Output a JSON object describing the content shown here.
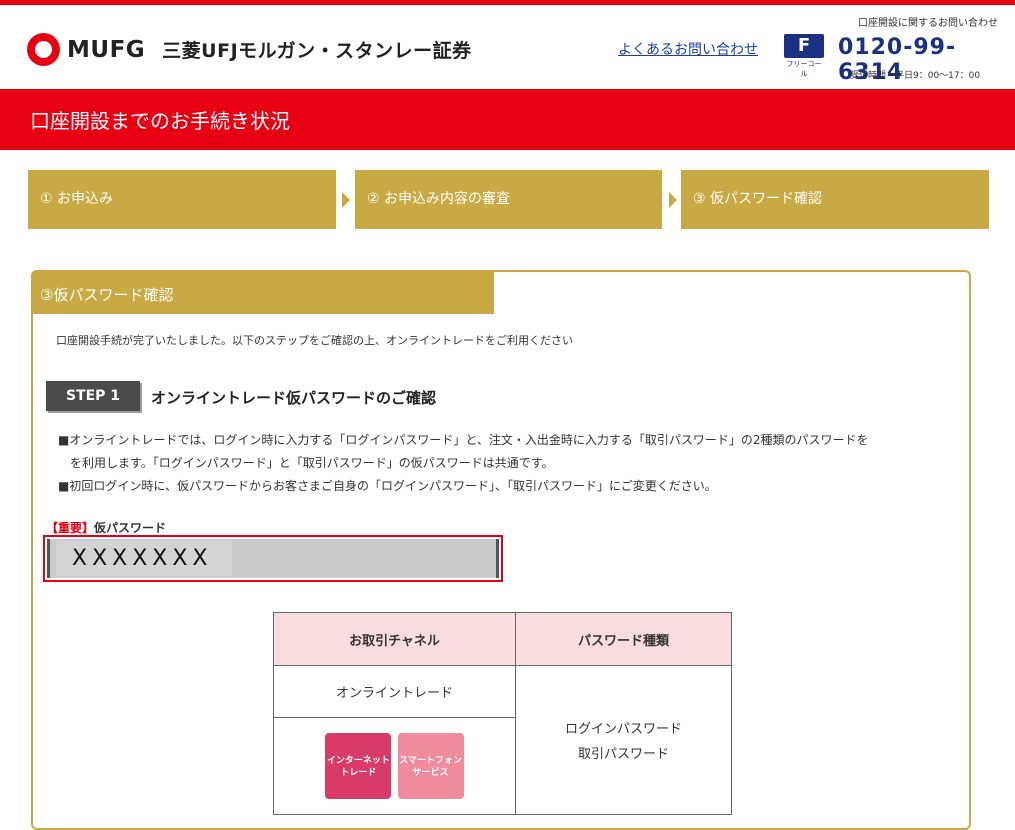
{
  "brand": {
    "logo_text": "MUFG",
    "company_name": "三菱UFJモルガン・スタンレー証券",
    "accent_color": "#e60012",
    "gold_color": "#c9a943"
  },
  "header": {
    "faq_link": "よくあるお問い合わせ",
    "freecall_icon": "freecall-icon",
    "freecall_label": "フリーコール",
    "phone_inquiry": "口座開設に関するお問い合わせ",
    "phone_number": "0120-99-6314",
    "hours": "受付時間　平日9：00〜17：00"
  },
  "banner": {
    "title": "口座開設までのお手続き状況"
  },
  "steps": [
    {
      "label": "① お申込み"
    },
    {
      "label": "② お申込み内容の審査"
    },
    {
      "label": "③ 仮パスワード確認"
    }
  ],
  "section": {
    "title": "③仮パスワード確認",
    "intro": "口座開設手続が完了いたしました。以下のステップをご確認の上、オンライントレードをご利用ください",
    "step_badge": "STEP 1",
    "step_title": "オンライントレード仮パスワードのご確認",
    "bullets": [
      "■オンライントレードでは、ログイン時に入力する「ログインパスワード」と、注文・入出金時に入力する「取引パスワード」の2種類のパスワードを",
      "　を利用します。「ログインパスワード」と「取引パスワード」の仮パスワードは共通です。",
      "■初回ログイン時に、仮パスワードからお客さまご自身の「ログインパスワード」、「取引パスワード」にご変更ください。"
    ],
    "important_tag": "【重要】",
    "important_label": "仮パスワード",
    "password": "XXXXXXX"
  },
  "table": {
    "headers": [
      "お取引チャネル",
      "パスワード種類"
    ],
    "channel_online": "オンライントレード",
    "tiles": [
      {
        "label_line1": "インターネット",
        "label_line2": "トレード",
        "color": "#d83a6a"
      },
      {
        "label_line1": "スマートフォン",
        "label_line2": "サービス",
        "color": "#f08a9e"
      }
    ],
    "password_type_line1": "ログインパスワード",
    "password_type_line2": "取引パスワード"
  }
}
